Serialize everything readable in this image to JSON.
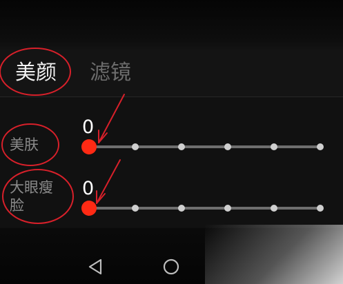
{
  "tabs": [
    {
      "label": "美颜",
      "active": true
    },
    {
      "label": "滤镜",
      "active": false
    }
  ],
  "settings": [
    {
      "label": "美肤",
      "value": "0",
      "level": 0,
      "steps": 6
    },
    {
      "label": "大眼瘦脸",
      "value": "0",
      "level": 0,
      "steps": 6
    }
  ],
  "colors": {
    "accent": "#ff2a14",
    "annotation": "#d8202a",
    "background": "#111111"
  },
  "nav": {
    "back_icon": "triangle-left",
    "home_icon": "circle"
  }
}
